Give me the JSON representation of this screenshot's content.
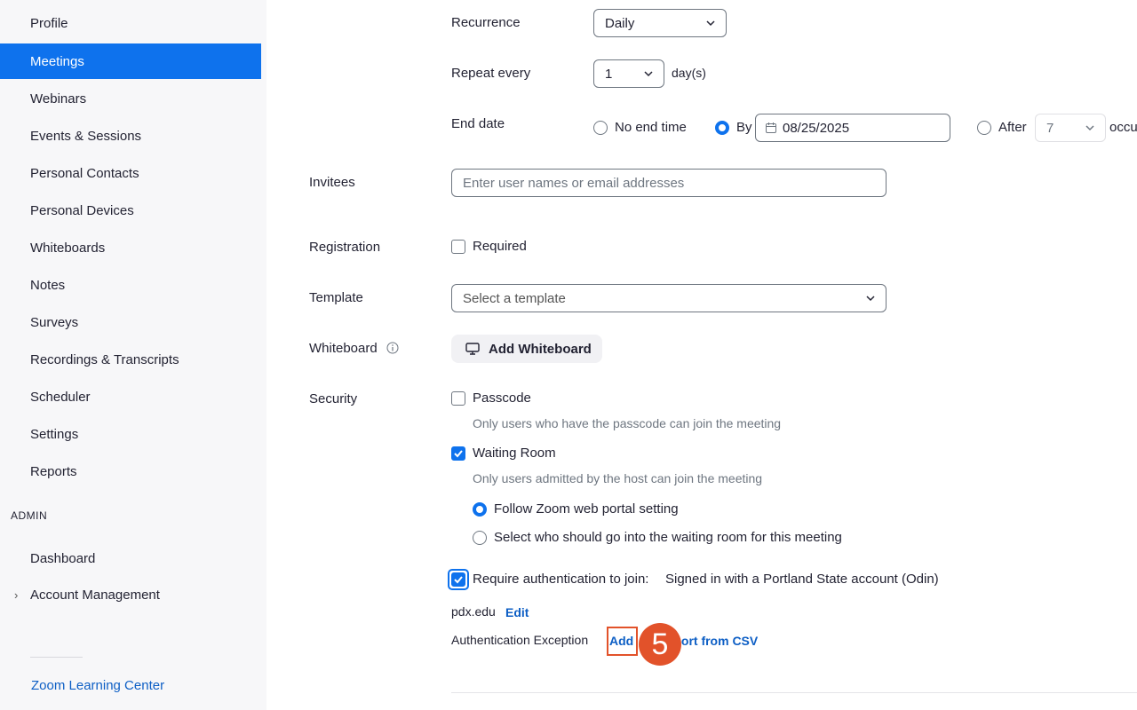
{
  "sidebar": {
    "items": [
      {
        "label": "Profile"
      },
      {
        "label": "Meetings"
      },
      {
        "label": "Webinars"
      },
      {
        "label": "Events & Sessions"
      },
      {
        "label": "Personal Contacts"
      },
      {
        "label": "Personal Devices"
      },
      {
        "label": "Whiteboards"
      },
      {
        "label": "Notes"
      },
      {
        "label": "Surveys"
      },
      {
        "label": "Recordings & Transcripts"
      },
      {
        "label": "Scheduler"
      },
      {
        "label": "Settings"
      },
      {
        "label": "Reports"
      }
    ],
    "admin_label": "ADMIN",
    "admin_items": [
      {
        "label": "Dashboard"
      },
      {
        "label": "Account Management"
      }
    ],
    "learning_center": "Zoom Learning Center"
  },
  "form": {
    "recurrence": {
      "label": "Recurrence",
      "value": "Daily"
    },
    "repeat_every": {
      "label": "Repeat every",
      "value": "1",
      "unit": "day(s)"
    },
    "end_date": {
      "label": "End date",
      "no_end_time": "No end time",
      "by": "By",
      "date_value": "08/25/2025",
      "after": "After",
      "after_value": "7",
      "occurrences_fragment": "occu"
    },
    "invitees": {
      "label": "Invitees",
      "placeholder": "Enter user names or email addresses"
    },
    "registration": {
      "label": "Registration",
      "required": "Required"
    },
    "template": {
      "label": "Template",
      "placeholder": "Select a template"
    },
    "whiteboard": {
      "label": "Whiteboard",
      "button": "Add Whiteboard"
    },
    "security": {
      "label": "Security",
      "passcode": "Passcode",
      "passcode_help": "Only users who have the passcode can join the meeting",
      "waiting_room": "Waiting Room",
      "waiting_room_help": "Only users admitted by the host can join the meeting",
      "follow_setting": "Follow Zoom web portal setting",
      "select_who": "Select who should go into the waiting room for this meeting",
      "require_auth": "Require authentication to join:",
      "auth_method": "Signed in with a Portland State account (Odin)",
      "domain": "pdx.edu",
      "edit": "Edit",
      "auth_exception": "Authentication Exception",
      "add": "Add",
      "import_csv": "Import from CSV"
    }
  },
  "annotation": {
    "step": "5"
  },
  "colors": {
    "accent": "#0e72ed",
    "link": "#0e5fc5",
    "annotation": "#e2522a"
  }
}
